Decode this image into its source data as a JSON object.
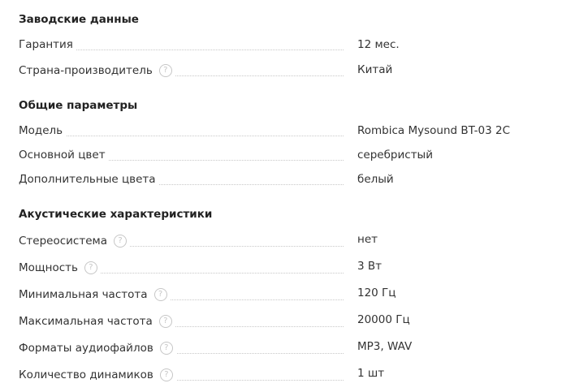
{
  "groups": [
    {
      "title": "Заводские данные",
      "rows": [
        {
          "label": "Гарантия",
          "value": "12 мес.",
          "help": false
        },
        {
          "label": "Страна-производитель",
          "value": "Китай",
          "help": true
        }
      ]
    },
    {
      "title": "Общие параметры",
      "rows": [
        {
          "label": "Модель",
          "value": "Rombica Mysound BT-03 2C",
          "help": false
        },
        {
          "label": "Основной цвет",
          "value": "серебристый",
          "help": false
        },
        {
          "label": "Дополнительные цвета",
          "value": "белый",
          "help": false
        }
      ]
    },
    {
      "title": "Акустические характеристики",
      "rows": [
        {
          "label": "Стереосистема",
          "value": "нет",
          "help": true
        },
        {
          "label": "Мощность",
          "value": "3 Вт",
          "help": true
        },
        {
          "label": "Минимальная частота",
          "value": "120 Гц",
          "help": true
        },
        {
          "label": "Максимальная частота",
          "value": "20000 Гц",
          "help": true
        },
        {
          "label": "Форматы аудиофайлов",
          "value": "MP3, WAV",
          "help": true
        },
        {
          "label": "Количество динамиков",
          "value": "1 шт",
          "help": true
        }
      ]
    }
  ],
  "help_icon_glyph": "?",
  "colors": {
    "text": "#333333",
    "title": "#222222",
    "icon": "#c6c6c6",
    "dots": "#c8c8c8"
  }
}
